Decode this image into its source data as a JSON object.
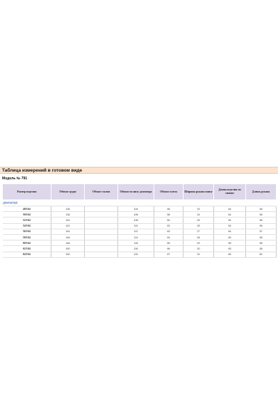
{
  "title": "Таблица измерений в готовом виде",
  "model": "Модель № 791",
  "headers": [
    "Размер изделия",
    "Обхват груди",
    "Обхват талии",
    "Обхват по низу джемпера",
    "Обхват плеча",
    "Ширина рукава внизу",
    "Длина изделия по спинке",
    "Длина рукава"
  ],
  "group": "Джемпер",
  "rows": [
    [
      "48/164",
      "136",
      "",
      "104",
      "56",
      "23",
      "64",
      "56"
    ],
    [
      "50/164",
      "136",
      "",
      "106",
      "58",
      "24",
      "64",
      "56"
    ],
    [
      "52/164",
      "140",
      "",
      "108",
      "60",
      "25",
      "64",
      "56"
    ],
    [
      "54/164",
      "142",
      "",
      "110",
      "62",
      "26",
      "64",
      "56"
    ],
    [
      "56/164",
      "144",
      "",
      "112",
      "63",
      "27",
      "64",
      "57"
    ],
    [
      "58/164",
      "146",
      "",
      "114",
      "64",
      "28",
      "65",
      "58"
    ],
    [
      "60/164",
      "148",
      "",
      "116",
      "65",
      "29",
      "65",
      "58"
    ],
    [
      "62/164",
      "150",
      "",
      "118",
      "66",
      "30",
      "65",
      "58"
    ],
    [
      "64/164",
      "152",
      "",
      "120",
      "67",
      "31",
      "65",
      "60"
    ]
  ],
  "colors": {
    "title_bg": "#fbe3cf",
    "header_bg": "#ddd7ea",
    "group_text": "#5b7fc4"
  }
}
